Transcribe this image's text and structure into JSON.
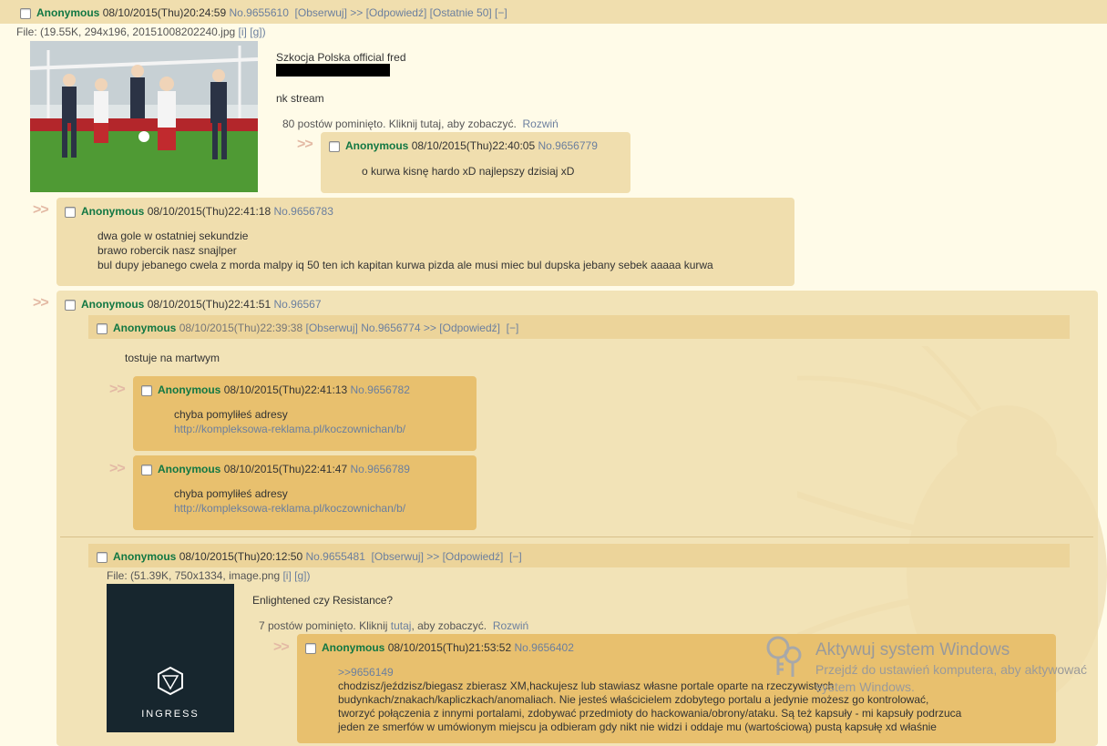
{
  "op": {
    "name": "Anonymous",
    "date": "08/10/2015(Thu)20:24:59",
    "no": "No.9655610",
    "watch": "[Obserwuj]",
    "reply": ">> [Odpowiedź]",
    "last50": "[Ostatnie 50]",
    "hide": "[−]",
    "file_info": "File: (19.55K, 294x196, 20151008202240.jpg",
    "file_i": "[i]",
    "file_g": "[g])",
    "subject_line": "Szkocja Polska official fred",
    "body_line2": "nk stream",
    "omitted": "80 postów pominięto. Kliknij tutaj, aby zobaczyć.",
    "expand": "Rozwiń"
  },
  "reply_9656779": {
    "arrow": ">>",
    "name": "Anonymous",
    "date": "08/10/2015(Thu)22:40:05",
    "no": "No.9656779",
    "text": "o kurwa kisnę hardo xD najlepszy dzisiaj xD"
  },
  "reply_9656783": {
    "arrow": ">>",
    "name": "Anonymous",
    "date": "08/10/2015(Thu)22:41:18",
    "no": "No.9656783",
    "lines": [
      "dwa gole w ostatniej sekundzie",
      "brawo robercik nasz snajlper",
      "bul dupy jebanego cwela z morda malpy iq 50 ten ich kapitan kurwa pizda ale musi miec bul dupska jebany sebek aaaaa kurwa"
    ]
  },
  "reply_96567": {
    "arrow": ">>",
    "name": "Anonymous",
    "date": "08/10/2015(Thu)22:41:51",
    "no": "No.96567"
  },
  "inner_op_1": {
    "name": "Anonymous",
    "date": "08/10/2015(Thu)22:39:38",
    "watch": "[Obserwuj]",
    "no": "No.9656774",
    "reply": ">> [Odpowiedź]",
    "hide": "[−]",
    "text": "tostuje na martwym"
  },
  "inner_reply_a": {
    "arrow": ">>",
    "name": "Anonymous",
    "date": "08/10/2015(Thu)22:41:13",
    "no": "No.9656782",
    "line1": "chyba pomyliłeś adresy",
    "line2": "http://kompleksowa-reklama.pl/koczownichan/b/"
  },
  "inner_reply_b": {
    "arrow": ">>",
    "name": "Anonymous",
    "date": "08/10/2015(Thu)22:41:47",
    "no": "No.9656789",
    "line1": "chyba pomyliłeś adresy",
    "line2": "http://kompleksowa-reklama.pl/koczownichan/b/"
  },
  "inner_op_2": {
    "name": "Anonymous",
    "date": "08/10/2015(Thu)20:12:50",
    "no": "No.9655481",
    "watch": "[Obserwuj]",
    "reply": ">> [Odpowiedź]",
    "hide": "[−]",
    "file_info": "File: (51.39K, 750x1334, image.png",
    "file_i": "[i]",
    "file_g": "[g])",
    "text": "Enlightened czy Resistance?",
    "omitted_a": "7 postów pominięto. Kliknij",
    "omitted_link": "tutaj",
    "omitted_b": ", aby zobaczyć.",
    "expand": "Rozwiń",
    "thumb_label": "INGRESS"
  },
  "inner_reply_c": {
    "arrow": ">>",
    "name": "Anonymous",
    "date": "08/10/2015(Thu)21:53:52",
    "no": "No.9656402",
    "lines": [
      ">>9656149",
      "chodzisz/jeździsz/biegasz zbierasz XM,hackujesz lub stawiasz własne portale oparte na rzeczywistych",
      "budynkach/znakach/kapliczkach/anomaliach. Nie jesteś właścicielem zdobytego portalu a jedynie możesz go kontrolować,",
      "tworzyć połączenia z innymi portalami, zdobywać przedmioty do hackowania/obrony/ataku. Są też kapsuły - mi kapsuły podrzuca",
      "jeden ze smerfów w umówionym miejscu ja odbieram gdy nikt nie widzi i oddaje mu (wartościową) pustą kapsułę xd właśnie"
    ]
  },
  "watermark": {
    "title": "Aktywuj system Windows",
    "line1": "Przejdź do ustawień komputera, aby aktywować",
    "line2": "system Windows."
  }
}
